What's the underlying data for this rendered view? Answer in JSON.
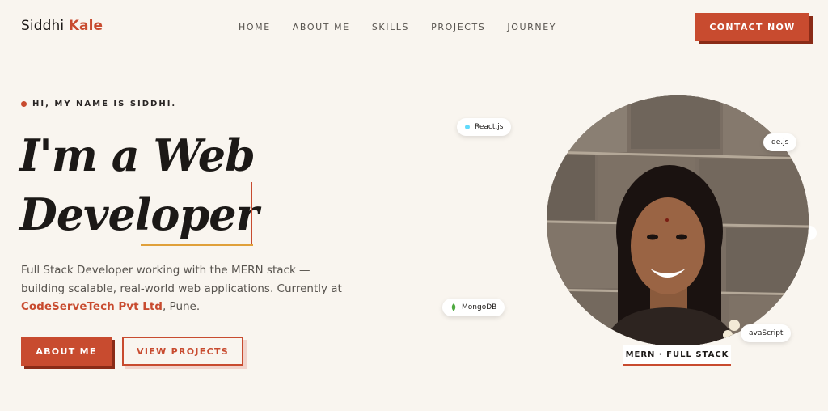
{
  "nav": {
    "logo_first": "Siddhi",
    "logo_last": "Kale",
    "items": [
      {
        "label": "HOME"
      },
      {
        "label": "ABOUT ME"
      },
      {
        "label": "SKILLS"
      },
      {
        "label": "PROJECTS"
      },
      {
        "label": "JOURNEY"
      }
    ],
    "cta_label": "CONTACT NOW"
  },
  "hero": {
    "eyebrow": "HI, MY NAME IS SIDDHI.",
    "headline_line1": "I'm a Web",
    "headline_line2": "Developer",
    "desc_part1": "Full Stack Developer working with the MERN stack — building scalable, real-world web applications. Currently at ",
    "company": "CodeServeTech Pvt Ltd",
    "desc_part2": ", Pune.",
    "primary_button": "ABOUT ME",
    "secondary_button": "VIEW PROJECTS"
  },
  "portrait": {
    "badge": "MERN · FULL STACK",
    "chips": [
      {
        "label": "React.js",
        "icon": "react-icon"
      },
      {
        "label": "de.js",
        "icon": "node-icon"
      },
      {
        "label": "MongoDB",
        "icon": "leaf-icon"
      },
      {
        "label": "avaScript",
        "icon": "javascript-icon"
      }
    ]
  },
  "colors": {
    "accent": "#c84b2f",
    "accent_dark": "#8a2b17",
    "background": "#f9f5ef",
    "underline": "#e0a03a",
    "react": "#61dafb",
    "mongodb": "#4faa41"
  }
}
